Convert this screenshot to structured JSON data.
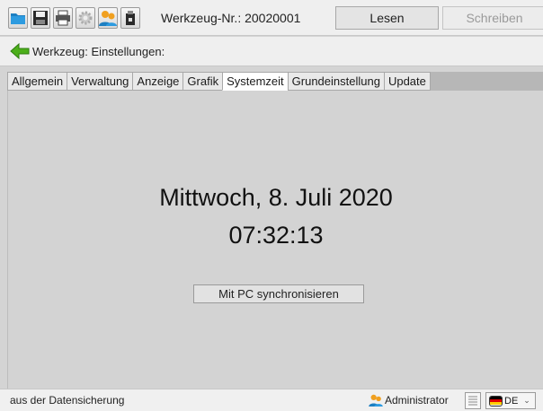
{
  "toolbar": {
    "icons": [
      "folder-open-icon",
      "save-icon",
      "print-icon",
      "gear-icon",
      "users-icon",
      "usb-device-icon"
    ],
    "tool_number": "Werkzeug-Nr.: 20020001",
    "read_label": "Lesen",
    "write_label": "Schreiben"
  },
  "breadcrumb": {
    "icon": "back-arrow-icon",
    "text": "Werkzeug: Einstellungen:"
  },
  "tabs": [
    {
      "label": "Allgemein"
    },
    {
      "label": "Verwaltung"
    },
    {
      "label": "Anzeige"
    },
    {
      "label": "Grafik"
    },
    {
      "label": "Systemzeit",
      "active": true
    },
    {
      "label": "Grundeinstellung"
    },
    {
      "label": "Update"
    }
  ],
  "main": {
    "date": "Mittwoch, 8. Juli 2020",
    "time": "07:32:13",
    "sync_label": "Mit PC synchronisieren"
  },
  "status": {
    "source": "aus der Datensicherung",
    "user": "Administrator",
    "language": "DE"
  },
  "colors": {
    "accent_green": "#4caf1a",
    "folder_blue": "#1d7fc2",
    "background": "#d4d4d4"
  }
}
